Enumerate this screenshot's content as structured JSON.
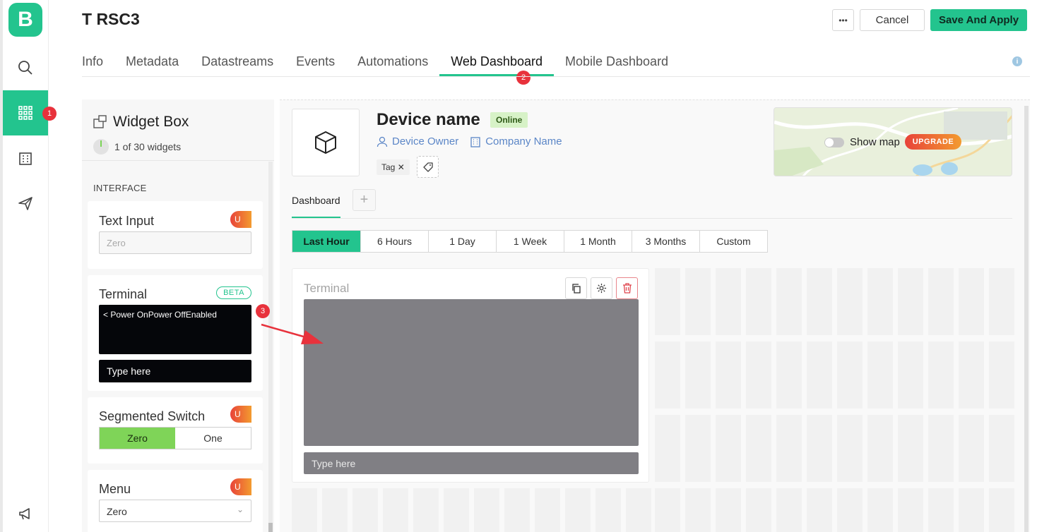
{
  "app": {
    "logo_letter": "B",
    "title": "T RSC3",
    "more_label": "•••",
    "cancel_label": "Cancel",
    "save_label": "Save And Apply",
    "accent_color": "#23c48e"
  },
  "rail": {
    "items": [
      {
        "icon": "search-icon"
      },
      {
        "icon": "grid-icon",
        "active": true,
        "badge": "1"
      },
      {
        "icon": "building-icon"
      },
      {
        "icon": "send-icon"
      },
      {
        "icon": "megaphone-icon"
      }
    ]
  },
  "tabs": [
    {
      "label": "Info"
    },
    {
      "label": "Metadata"
    },
    {
      "label": "Datastreams"
    },
    {
      "label": "Events"
    },
    {
      "label": "Automations"
    },
    {
      "label": "Web Dashboard",
      "active": true,
      "badge": "2"
    },
    {
      "label": "Mobile Dashboard"
    }
  ],
  "info_icon_label": "i",
  "widget_box": {
    "title": "Widget Box",
    "count": "1 of 30 widgets",
    "section": "INTERFACE",
    "widgets": [
      {
        "name": "Text Input",
        "placeholder": "Zero"
      },
      {
        "name": "Terminal",
        "badge": "BETA",
        "screen_text": "< Power OnPower OffEnabled",
        "input_text": "Type here"
      },
      {
        "name": "Segmented Switch",
        "options": [
          "Zero",
          "One"
        ]
      },
      {
        "name": "Menu",
        "selected": "Zero"
      }
    ],
    "lock_glyph": "U"
  },
  "device": {
    "name": "Device name",
    "status": "Online",
    "owner": "Device Owner",
    "company": "Company Name",
    "tag": "Tag"
  },
  "map": {
    "label": "Show map",
    "upgrade": "UPGRADE"
  },
  "dashboard": {
    "tab": "Dashboard",
    "add": "+",
    "ranges": [
      "Last Hour",
      "6 Hours",
      "1 Day",
      "1 Week",
      "1 Month",
      "3 Months",
      "Custom"
    ],
    "selected_range": "Last Hour"
  },
  "terminal_widget": {
    "title": "Terminal",
    "input_text": "Type here",
    "marker": "3"
  }
}
